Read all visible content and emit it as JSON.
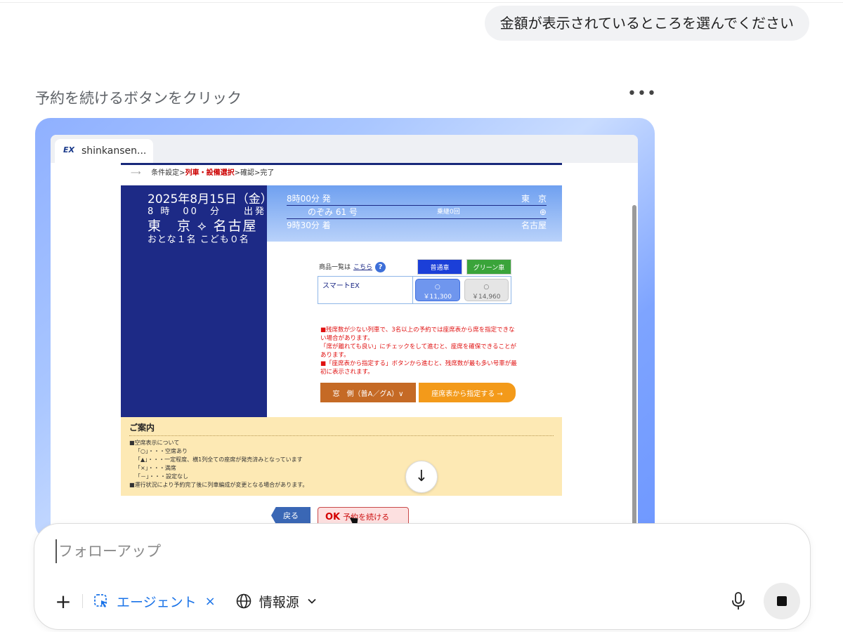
{
  "chat": {
    "user_message": "金額が表示されているところを選んでください",
    "step_title": "予約を続けるボタンをクリック",
    "more_label": "•••"
  },
  "browser": {
    "tab_title": "shinkansen...",
    "favicon_text": "EX"
  },
  "site": {
    "breadcrumb": {
      "prefix": "条件設定>",
      "current": "列車・設備選択",
      "suffix": ">確認>完了"
    },
    "trip": {
      "date": "2025年8月15日（金）",
      "time": "8 時　00　分　　出発",
      "route": "東　京 ⟡ 名古屋",
      "passengers": "おとな１名 こども０名"
    },
    "train": {
      "depart_time": "8時00分 発",
      "depart_station": "東　京",
      "name": "のぞみ 61 号",
      "transfers": "乗継0回",
      "expand_icon": "⊕",
      "arrive_time": "9時30分 着",
      "arrive_station": "名古屋"
    },
    "fares": {
      "list_label": "商品一覧は",
      "list_link": "こちら",
      "help": "?",
      "standard_label": "普通車",
      "green_label": "グリーン車",
      "product": "スマートEX",
      "standard_mark": "○",
      "standard_price": "￥11,300",
      "green_mark": "○",
      "green_price": "￥14,960"
    },
    "notice": [
      "■残席数が少ない列車で、3名以上の予約では座席表から席を指定できない場合があります。",
      "「席が離れても良い」にチェックをして進むと、座席を確保できることがあります。",
      "■「座席表から指定する」ボタンから進むと、残席数が最も多い号車が最初に表示されます。"
    ],
    "seat_window": "窓　側（普A／グA）∨",
    "seat_map": "座席表から指定する →",
    "guide": {
      "title": "ご案内",
      "lines": [
        "■空席表示について",
        "「○」・・・空席あり",
        "「▲」・・・一定程度、横1列全ての座席が発売済みとなっています",
        "「×」・・・満席",
        "「－」・・・設定なし",
        "■運行状況により予約完了後に列車編成が変更となる場合があります。"
      ]
    },
    "back_button": "戻る",
    "continue_ok": "OK",
    "continue_label": "予約を続ける",
    "scroll_down": "↓"
  },
  "composer": {
    "placeholder": "フォローアップ",
    "plus": "+",
    "agent_label": "エージェント",
    "agent_close": "×",
    "sources_label": "情報源"
  }
}
